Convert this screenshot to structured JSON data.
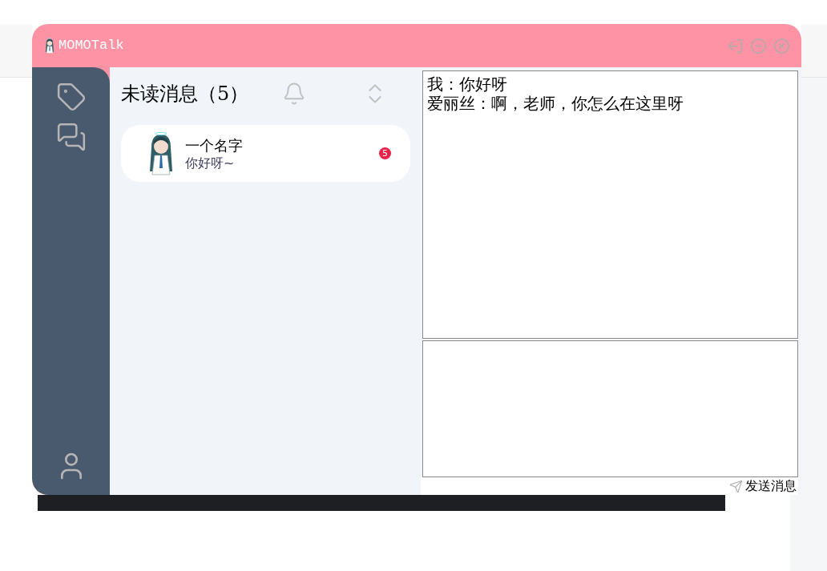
{
  "window": {
    "title": "MOMOTalk"
  },
  "unread": {
    "title": "未读消息（5）"
  },
  "contacts": [
    {
      "name": "一个名字",
      "preview": "你好呀~",
      "badge": "5"
    }
  ],
  "messages": [
    "我：你好呀",
    "爱丽丝：啊，老师，你怎么在这里呀"
  ],
  "send_button": "发送消息"
}
